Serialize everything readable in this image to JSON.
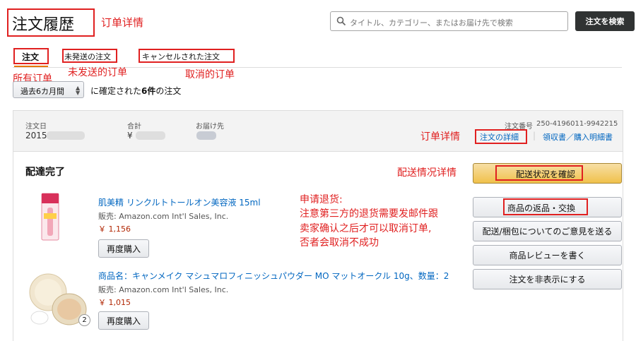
{
  "header": {
    "page_title": "注文履歴",
    "search_placeholder": "タイトル、カテゴリー、またはお届け先で検索",
    "search_button": "注文を検索"
  },
  "tabs": [
    {
      "label": "注文"
    },
    {
      "label": "未発送の注文"
    },
    {
      "label": "キャンセルされた注文"
    }
  ],
  "filter": {
    "period": "過去6カ月間",
    "text_before": "に確定された",
    "count": "6件",
    "text_after": "の注文"
  },
  "order": {
    "date_label": "注文日",
    "date_value": "2015",
    "total_label": "合計",
    "total_value": "¥",
    "ship_label": "お届け先",
    "number_label": "注文番号",
    "number_value": "250-4196011-9942215",
    "details_link": "注文の詳細",
    "receipt_link": "領収書／購入明細書",
    "status": "配達完了"
  },
  "items": [
    {
      "title": "肌美精 リンクルトトールオン美容液 15ml",
      "seller": "販売: Amazon.com Int'l Sales, Inc.",
      "price": "￥ 1,156",
      "rebuy": "再度購入"
    },
    {
      "title": "商品名：キャンメイク マシュマロフィニッシュパウダー MO マットオークル 10g、数量：2",
      "seller": "販売: Amazon.com Int'l Sales, Inc.",
      "price": "￥ 1,015",
      "rebuy": "再度購入",
      "qty_badge": "2"
    }
  ],
  "actions": {
    "track": "配送状況を確認",
    "return": "商品の返品・交換",
    "feedback": "配送/梱包についてのご意見を送る",
    "review": "商品レビューを書く",
    "hide": "注文を非表示にする"
  },
  "annotations": {
    "order_details": "订单详情",
    "all_orders": "所有订单",
    "unshipped": "未发送的订单",
    "cancelled": "取消的订单",
    "order_details_2": "订单详情",
    "shipping_status": "配送情况详情",
    "return_note_1": "申请退货:",
    "return_note_2": "注意第三方的退货需要发邮件跟",
    "return_note_3": "卖家确认之后才可以取消订单,",
    "return_note_4": "否者会取消不成功"
  },
  "colors": {
    "annotation_red": "#e02020",
    "link_blue": "#0066c0",
    "price_red": "#b12704",
    "track_button": "#f0c14b",
    "search_button": "#303333"
  }
}
